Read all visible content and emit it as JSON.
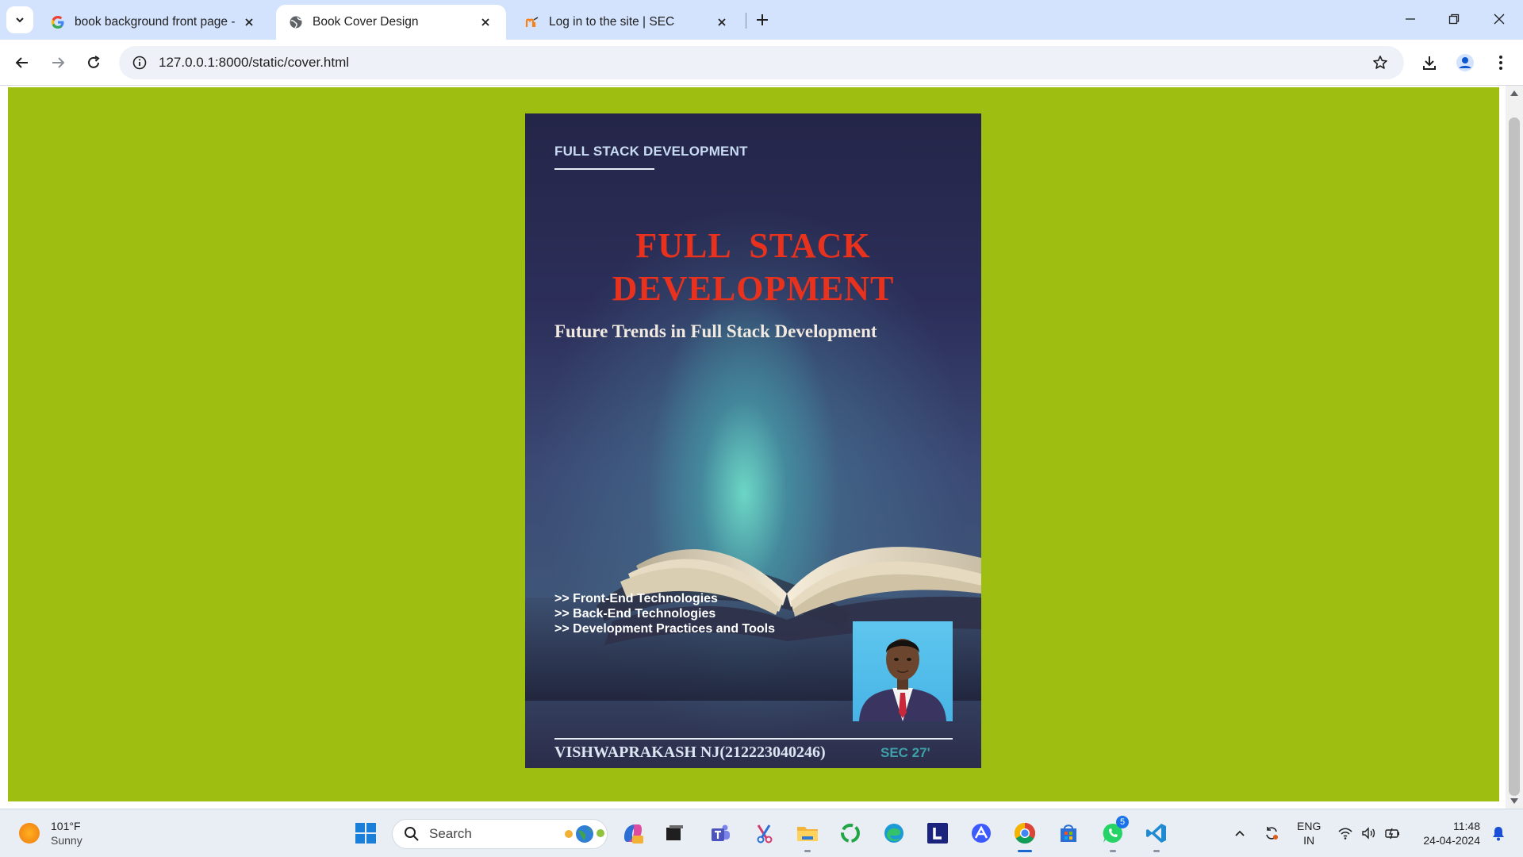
{
  "browser": {
    "tabs": [
      {
        "title": "book background front page -",
        "favicon": "google-icon",
        "active": false
      },
      {
        "title": "Book Cover Design",
        "favicon": "globe-icon",
        "active": true
      },
      {
        "title": "Log in to the site | SEC",
        "favicon": "moodle-icon",
        "active": false
      }
    ],
    "url": "127.0.0.1:8000/static/cover.html"
  },
  "page": {
    "background_color": "#9ebf12"
  },
  "cover": {
    "eyebrow": "FULL STACK DEVELOPMENT",
    "title_line1": "FULL  STACK",
    "title_line2": "DEVELOPMENT",
    "subtitle": "Future Trends in Full Stack Development",
    "topics": [
      ">> Front-End Technologies",
      ">> Back-End Technologies",
      ">> Development Practices and Tools"
    ],
    "author": "VISHWAPRAKASH NJ(212223040246)",
    "section": "SEC 27'",
    "colors": {
      "title": "#e8321e",
      "eyebrow": "#c9dcf5",
      "section": "#3ea0a8"
    }
  },
  "taskbar": {
    "weather": {
      "temp": "101°F",
      "condition": "Sunny"
    },
    "search_label": "Search",
    "whatsapp_badge": "5",
    "language": {
      "line1": "ENG",
      "line2": "IN"
    },
    "time": "11:48",
    "date": "24-04-2024"
  }
}
